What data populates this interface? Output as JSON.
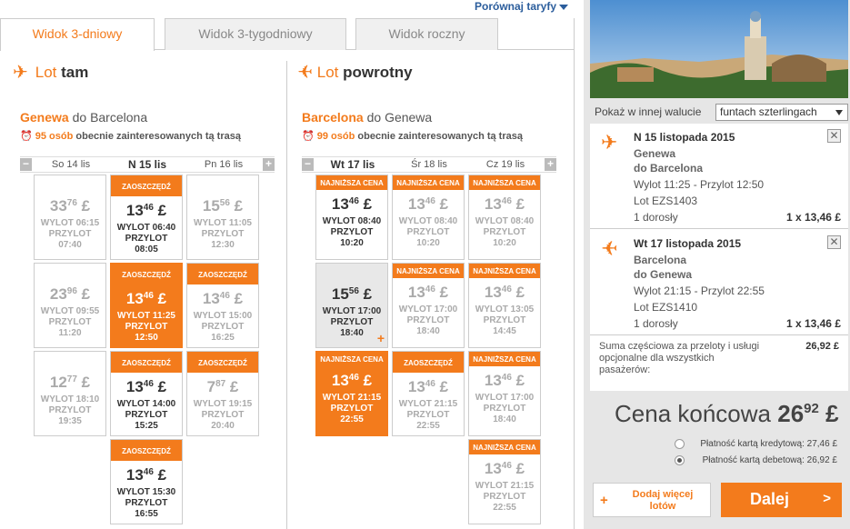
{
  "header": {
    "compare_label": "Porównaj taryfy",
    "tabs": [
      {
        "label": "Widok 3-dniowy",
        "active": true
      },
      {
        "label": "Widok 3-tygodniowy",
        "active": false
      },
      {
        "label": "Widok roczny",
        "active": false
      }
    ]
  },
  "outbound": {
    "title_lot": "Lot",
    "title_word": "tam",
    "route_from": "Genewa",
    "route_mid": "do",
    "route_to": "Barcelona",
    "interest_count": "95 osób",
    "interest_text": "obecnie zainteresowanych tą trasą",
    "days": [
      "So 14 lis",
      "N 15 lis",
      "Pn 16 lis"
    ],
    "cells": [
      {
        "col": 0,
        "row": 0,
        "tag": "",
        "price_main": "33",
        "price_dec": "76",
        "currency": "£",
        "dep": "WYLOT 06:15",
        "arr_label": "PRZYLOT",
        "arr": "07:40",
        "style": "plain"
      },
      {
        "col": 0,
        "row": 1,
        "tag": "",
        "price_main": "23",
        "price_dec": "96",
        "currency": "£",
        "dep": "WYLOT 09:55",
        "arr_label": "PRZYLOT",
        "arr": "11:20",
        "style": "plain"
      },
      {
        "col": 0,
        "row": 2,
        "tag": "",
        "price_main": "12",
        "price_dec": "77",
        "currency": "£",
        "dep": "WYLOT 18:10",
        "arr_label": "PRZYLOT",
        "arr": "19:35",
        "style": "plain"
      },
      {
        "col": 1,
        "row": 0,
        "tag": "ZAOSZCZĘDŹ",
        "price_main": "13",
        "price_dec": "46",
        "currency": "£",
        "dep": "WYLOT 06:40",
        "arr_label": "PRZYLOT",
        "arr": "08:05",
        "style": "save"
      },
      {
        "col": 1,
        "row": 1,
        "tag": "ZAOSZCZĘDŹ",
        "price_main": "13",
        "price_dec": "46",
        "currency": "£",
        "dep": "WYLOT 11:25",
        "arr_label": "PRZYLOT",
        "arr": "12:50",
        "style": "orange"
      },
      {
        "col": 1,
        "row": 2,
        "tag": "ZAOSZCZĘDŹ",
        "price_main": "13",
        "price_dec": "46",
        "currency": "£",
        "dep": "WYLOT 14:00",
        "arr_label": "PRZYLOT",
        "arr": "15:25",
        "style": "save"
      },
      {
        "col": 1,
        "row": 3,
        "tag": "ZAOSZCZĘDŹ",
        "price_main": "13",
        "price_dec": "46",
        "currency": "£",
        "dep": "WYLOT 15:30",
        "arr_label": "PRZYLOT",
        "arr": "16:55",
        "style": "save"
      },
      {
        "col": 2,
        "row": 0,
        "tag": "",
        "price_main": "15",
        "price_dec": "56",
        "currency": "£",
        "dep": "WYLOT 11:05",
        "arr_label": "PRZYLOT",
        "arr": "12:30",
        "style": "plain"
      },
      {
        "col": 2,
        "row": 1,
        "tag": "ZAOSZCZĘDŹ",
        "price_main": "13",
        "price_dec": "46",
        "currency": "£",
        "dep": "WYLOT 15:00",
        "arr_label": "PRZYLOT",
        "arr": "16:25",
        "style": "plainsave"
      },
      {
        "col": 2,
        "row": 2,
        "tag": "ZAOSZCZĘDŹ",
        "price_main": "7",
        "price_dec": "87",
        "currency": "£",
        "dep": "WYLOT 19:15",
        "arr_label": "PRZYLOT",
        "arr": "20:40",
        "style": "plainsave"
      }
    ]
  },
  "inbound": {
    "title_lot": "Lot",
    "title_word": "powrotny",
    "route_from": "Barcelona",
    "route_mid": "do",
    "route_to": "Genewa",
    "interest_count": "99 osób",
    "interest_text": "obecnie zainteresowanych tą trasą",
    "days": [
      "Wt 17 lis",
      "Śr 18 lis",
      "Cz 19 lis"
    ],
    "cells": [
      {
        "col": 0,
        "row": 0,
        "tag": "NAJNIŻSZA CENA",
        "price_main": "13",
        "price_dec": "46",
        "currency": "£",
        "dep": "WYLOT 08:40",
        "arr_label": "PRZYLOT",
        "arr": "10:20",
        "style": "save"
      },
      {
        "col": 0,
        "row": 1,
        "tag": "",
        "price_main": "15",
        "price_dec": "56",
        "currency": "£",
        "dep": "WYLOT 17:00",
        "arr_label": "PRZYLOT",
        "arr": "18:40",
        "style": "grey"
      },
      {
        "col": 0,
        "row": 2,
        "tag": "NAJNIŻSZA CENA",
        "price_main": "13",
        "price_dec": "46",
        "currency": "£",
        "dep": "WYLOT 21:15",
        "arr_label": "PRZYLOT",
        "arr": "22:55",
        "style": "orange"
      },
      {
        "col": 1,
        "row": 0,
        "tag": "NAJNIŻSZA CENA",
        "price_main": "13",
        "price_dec": "46",
        "currency": "£",
        "dep": "WYLOT 08:40",
        "arr_label": "PRZYLOT",
        "arr": "10:20",
        "style": "plainsave"
      },
      {
        "col": 1,
        "row": 1,
        "tag": "NAJNIŻSZA CENA",
        "price_main": "13",
        "price_dec": "46",
        "currency": "£",
        "dep": "WYLOT 17:00",
        "arr_label": "PRZYLOT",
        "arr": "18:40",
        "style": "plainsave"
      },
      {
        "col": 1,
        "row": 2,
        "tag": "ZAOSZCZĘDŹ",
        "price_main": "13",
        "price_dec": "46",
        "currency": "£",
        "dep": "WYLOT 21:15",
        "arr_label": "PRZYLOT",
        "arr": "22:55",
        "style": "plainsave"
      },
      {
        "col": 2,
        "row": 0,
        "tag": "NAJNIŻSZA CENA",
        "price_main": "13",
        "price_dec": "46",
        "currency": "£",
        "dep": "WYLOT 08:40",
        "arr_label": "PRZYLOT",
        "arr": "10:20",
        "style": "plainsave"
      },
      {
        "col": 2,
        "row": 1,
        "tag": "NAJNIŻSZA CENA",
        "price_main": "13",
        "price_dec": "46",
        "currency": "£",
        "dep": "WYLOT 13:05",
        "arr_label": "PRZYLOT",
        "arr": "14:45",
        "style": "plainsave"
      },
      {
        "col": 2,
        "row": 2,
        "tag": "NAJNIŻSZA CENA",
        "price_main": "13",
        "price_dec": "46",
        "currency": "£",
        "dep": "WYLOT 17:00",
        "arr_label": "PRZYLOT",
        "arr": "18:40",
        "style": "plainsave"
      },
      {
        "col": 2,
        "row": 3,
        "tag": "NAJNIŻSZA CENA",
        "price_main": "13",
        "price_dec": "46",
        "currency": "£",
        "dep": "WYLOT 21:15",
        "arr_label": "PRZYLOT",
        "arr": "22:55",
        "style": "plainsave"
      }
    ]
  },
  "sidebar": {
    "currency_label": "Pokaż w innej walucie",
    "currency_value": "funtach szterlingach",
    "legs": [
      {
        "date": "N 15 listopada 2015",
        "from": "Genewa",
        "to": "do Barcelona",
        "times": "Wylot 11:25 - Przylot 12:50",
        "flight": "Lot EZS1403",
        "pax": "1 dorosły",
        "mult": "1 x 13,46 £"
      },
      {
        "date": "Wt 17 listopada 2015",
        "from": "Barcelona",
        "to": "do Genewa",
        "times": "Wylot 21:15 - Przylot 22:55",
        "flight": "Lot EZS1410",
        "pax": "1 dorosły",
        "mult": "1 x 13,46 £"
      }
    ],
    "subtotal_text": "Suma częściowa za przeloty i usługi opcjonalne dla wszystkich pasażerów:",
    "subtotal_amount": "26,92 £",
    "total_label": "Cena końcowa",
    "total_main": "26",
    "total_dec": "92",
    "total_currency": "£",
    "pay_credit": "Płatność kartą kredytową: 27,46 £",
    "pay_debit": "Płatność kartą debetową: 26,92 £",
    "add_flights": "Dodaj więcej lotów",
    "next": "Dalej"
  },
  "colors": {
    "accent": "#f37b1c",
    "link": "#2b5d9c"
  }
}
